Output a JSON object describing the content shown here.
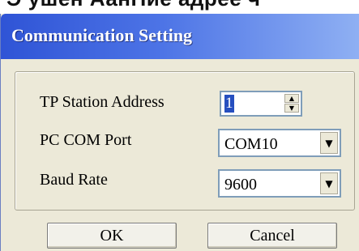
{
  "background_text": "Э ушен АанНие адрее ч",
  "dialog": {
    "title": "Communication Setting",
    "fields": [
      {
        "label": "TP Station Address",
        "value": "1",
        "control": "spinner"
      },
      {
        "label": "PC COM Port",
        "value": "COM10",
        "control": "dropdown"
      },
      {
        "label": "Baud Rate",
        "value": "9600",
        "control": "dropdown"
      }
    ],
    "buttons": {
      "ok": "OK",
      "cancel": "Cancel"
    },
    "icons": {
      "spin_up": "up-arrow",
      "spin_down": "down-arrow",
      "dropdown": "chevron-down"
    }
  }
}
